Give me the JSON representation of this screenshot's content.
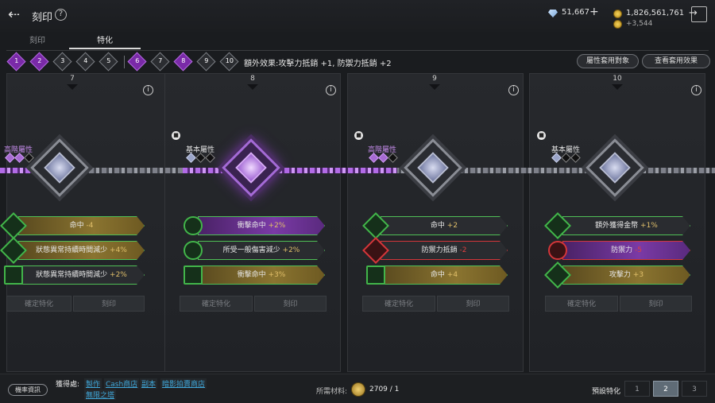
{
  "header": {
    "title": "刻印",
    "diamonds": "51,667",
    "plus": "+",
    "gold": "1,826,561,761",
    "gold_bonus": "+3,544"
  },
  "tabs": [
    "刻印",
    "特化"
  ],
  "steps": [
    "1",
    "2",
    "3",
    "4",
    "5",
    "6",
    "7",
    "8",
    "9",
    "10"
  ],
  "effect_text": "額外效果:攻擊力抵銷 +1, 防禦力抵銷 +2",
  "buttons": {
    "apply_target": "屬性套用對象",
    "view_effect": "查看套用效果",
    "confirm": "確定特化",
    "engrave": "刻印"
  },
  "panels": [
    {
      "num": "7",
      "type": "高階屬性",
      "stats": [
        {
          "name": "命中",
          "val": "-4"
        },
        {
          "name": "狀態異常持續時間減少",
          "val": "+4%"
        },
        {
          "name": "狀態異常持續時間減少",
          "val": "+2%"
        }
      ]
    },
    {
      "num": "8",
      "type": "基本屬性",
      "stats": [
        {
          "name": "衝擊命中",
          "val": "+2%"
        },
        {
          "name": "所受一般傷害減少",
          "val": "+2%"
        },
        {
          "name": "衝擊命中",
          "val": "+3%"
        }
      ]
    },
    {
      "num": "9",
      "type": "高階屬性",
      "stats": [
        {
          "name": "命中",
          "val": "+2"
        },
        {
          "name": "防禦力抵銷",
          "val": "-2"
        },
        {
          "name": "命中",
          "val": "+4"
        }
      ]
    },
    {
      "num": "10",
      "type": "基本屬性",
      "stats": [
        {
          "name": "額外獲得金幣",
          "val": "+1%"
        },
        {
          "name": "防禦力",
          "val": "-5"
        },
        {
          "name": "攻擊力",
          "val": "+3"
        }
      ]
    }
  ],
  "footer": {
    "prob": "機率資訊",
    "source_label": "獲得處:",
    "links": [
      "製作",
      "Cash商店",
      "副本",
      "暗影拍賣商店",
      "無限之塔"
    ],
    "material_label": "所需材料:",
    "material_value": "2709 / 1",
    "preset_label": "預設特化",
    "presets": [
      "1",
      "2",
      "3"
    ]
  },
  "colors": {
    "accent_purple": "#7a2aa8",
    "green": "#42b54a",
    "red": "#d4363a",
    "gold": "#e0bf6a"
  }
}
